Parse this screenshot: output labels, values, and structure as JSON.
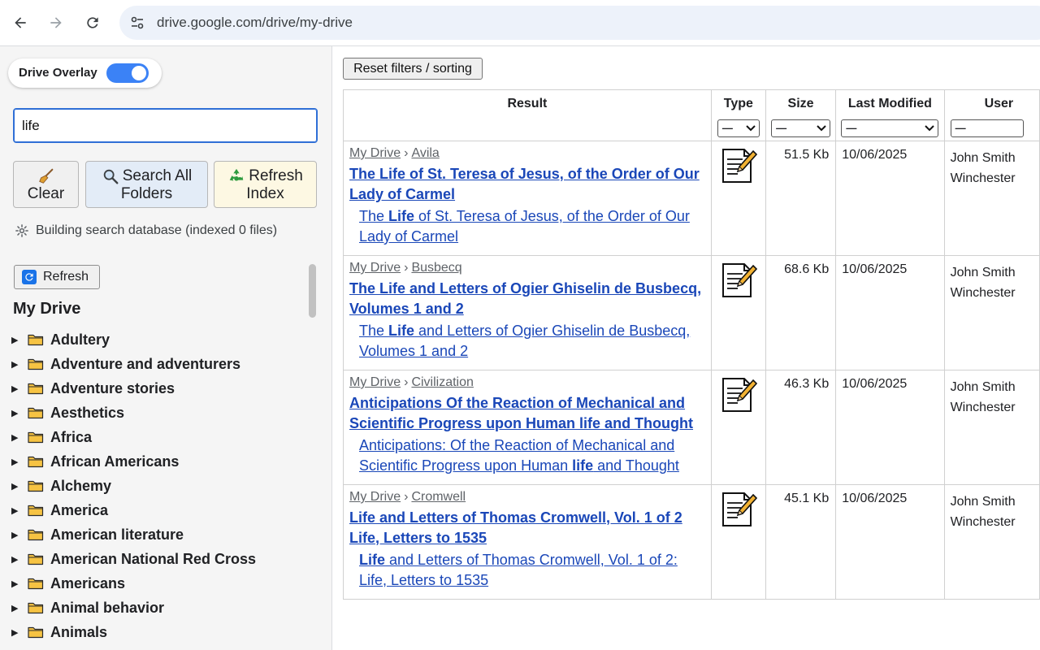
{
  "browser": {
    "url": "drive.google.com/drive/my-drive"
  },
  "overlay": {
    "label": "Drive Overlay",
    "enabled": true
  },
  "search": {
    "value": "life"
  },
  "actions": {
    "clear_label": "Clear",
    "search_all_label_1": "Search All",
    "search_all_label_2": "Folders",
    "refresh_index_label_1": "Refresh",
    "refresh_index_label_2": "Index"
  },
  "status": {
    "text": "Building search database (indexed 0 files)"
  },
  "tree": {
    "refresh_label": "Refresh",
    "title": "My Drive",
    "folders": [
      "Adultery",
      "Adventure and adventurers",
      "Adventure stories",
      "Aesthetics",
      "Africa",
      "African Americans",
      "Alchemy",
      "America",
      "American literature",
      "American National Red Cross",
      "Americans",
      "Animal behavior",
      "Animals"
    ]
  },
  "results": {
    "reset_label": "Reset filters / sorting",
    "columns": {
      "result": "Result",
      "type": "Type",
      "size": "Size",
      "modified": "Last Modified",
      "user": "User"
    },
    "filter_default": "—",
    "rows": [
      {
        "crumb_root": "My Drive",
        "crumb_sep": "›",
        "crumb_folder": "Avila",
        "title": "The Life of St. Teresa of Jesus, of the Order of Our Lady of Carmel",
        "sub_pre": "The ",
        "sub_match": "Life",
        "sub_post": " of St. Teresa of Jesus, of the Order of Our Lady of Carmel",
        "type_icon": "document-pencil-icon",
        "size": "51.5 Kb",
        "modified": "10/06/2025",
        "user_line1": "John Smith",
        "user_line2": "Winchester"
      },
      {
        "crumb_root": "My Drive",
        "crumb_sep": "›",
        "crumb_folder": "Busbecq",
        "title": "The Life and Letters of Ogier Ghiselin de Busbecq, Volumes 1 and 2",
        "sub_pre": "The ",
        "sub_match": "Life",
        "sub_post": " and Letters of Ogier Ghiselin de Busbecq, Volumes 1 and 2",
        "type_icon": "document-pencil-icon",
        "size": "68.6 Kb",
        "modified": "10/06/2025",
        "user_line1": "John Smith",
        "user_line2": "Winchester"
      },
      {
        "crumb_root": "My Drive",
        "crumb_sep": "›",
        "crumb_folder": "Civilization",
        "title": "Anticipations Of the Reaction of Mechanical and Scientific Progress upon Human life and Thought",
        "sub_pre": "Anticipations: Of the Reaction of Mechanical and Scientific Progress upon Human ",
        "sub_match": "life",
        "sub_post": " and Thought",
        "type_icon": "document-pencil-icon",
        "size": "46.3 Kb",
        "modified": "10/06/2025",
        "user_line1": "John Smith",
        "user_line2": "Winchester"
      },
      {
        "crumb_root": "My Drive",
        "crumb_sep": "›",
        "crumb_folder": "Cromwell",
        "title": "Life and Letters of Thomas Cromwell, Vol. 1 of 2 Life, Letters to 1535",
        "sub_pre": "",
        "sub_match": "Life",
        "sub_post": " and Letters of Thomas Cromwell, Vol. 1 of 2: Life, Letters to 1535",
        "type_icon": "document-pencil-icon",
        "size": "45.1 Kb",
        "modified": "10/06/2025",
        "user_line1": "John Smith",
        "user_line2": "Winchester"
      }
    ]
  },
  "colors": {
    "link": "#1a47b8",
    "toggle_on": "#3b82f6",
    "omnibox_bg": "#edf2fa",
    "panel_bg": "#f5f5f5"
  }
}
